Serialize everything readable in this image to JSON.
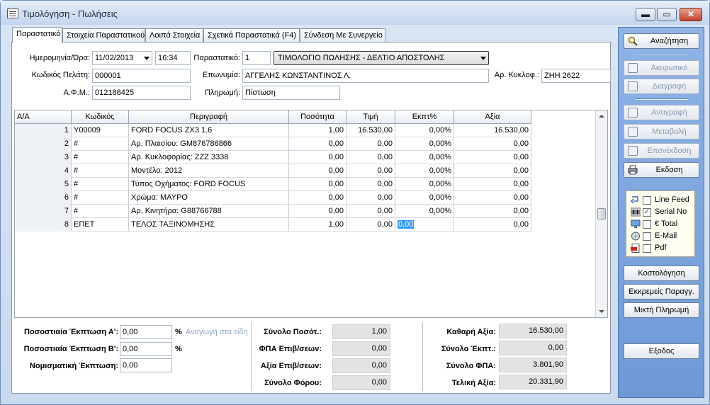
{
  "window": {
    "title": "Τιμολόγηση - Πωλήσεις",
    "min_glyph": "▬",
    "max_glyph": "▭",
    "close_glyph": "✕"
  },
  "tabs": [
    {
      "label": "Παραστατικό"
    },
    {
      "label": "Στοιχεία Παραστατικού"
    },
    {
      "label": "Λοιπά Στοιχεία"
    },
    {
      "label": "Σχετικά Παραστατικά (F4)"
    },
    {
      "label": "Σύνδεση Με Συνεργείο"
    }
  ],
  "header": {
    "date_label": "Ημερομηνία/Ώρα:",
    "date_value": "11/02/2013",
    "time_value": "16:34",
    "doc_label": "Παραστατικό:",
    "doc_number": "1",
    "doc_type": "ΤΙΜΟΛΟΓΙΟ ΠΩΛΗΣΗΣ - ΔΕΛΤΙΟ ΑΠΟΣΤΟΛΗΣ",
    "customer_code_label": "Κωδικός Πελάτη:",
    "customer_code": "000001",
    "name_label": "Επωνυμία:",
    "name_value": "ΑΓΓΕΛΗΣ ΚΩΝΣΤΑΝΤΙΝΟΣ Λ.",
    "plate_label": "Αρ. Κυκλοφ.:",
    "plate_value": "ΖΗΗ 2622",
    "afm_label": "Α.Φ.Μ.:",
    "afm_value": "012188425",
    "payment_label": "Πληρωμή:",
    "payment_value": "Πίστωση"
  },
  "grid": {
    "columns": [
      "Α/Α",
      "Κωδικός",
      "Περιγραφή",
      "Ποσότητα",
      "Τιμή",
      "Εκπτ%",
      "Αξία"
    ],
    "rows": [
      {
        "aa": "1",
        "code": "Y00009",
        "desc": "FORD FOCUS ZX3 1.6",
        "qty": "1,00",
        "price": "16.530,00",
        "disc": "0,00%",
        "value": "16.530,00"
      },
      {
        "aa": "2",
        "code": "#",
        "desc": "Αρ. Πλαισίου: GM876786866",
        "qty": "0,00",
        "price": "0,00",
        "disc": "0,00%",
        "value": "0,00"
      },
      {
        "aa": "3",
        "code": "#",
        "desc": "Αρ. Κυκλοφορίας: ZZZ 3338",
        "qty": "0,00",
        "price": "0,00",
        "disc": "0,00%",
        "value": "0,00"
      },
      {
        "aa": "4",
        "code": "#",
        "desc": "Μοντέλο: 2012",
        "qty": "0,00",
        "price": "0,00",
        "disc": "0,00%",
        "value": "0,00"
      },
      {
        "aa": "5",
        "code": "#",
        "desc": "Τύπος Οχήματος: FORD FOCUS",
        "qty": "0,00",
        "price": "0,00",
        "disc": "0,00%",
        "value": "0,00"
      },
      {
        "aa": "6",
        "code": "#",
        "desc": "Χρώμα: ΜΑΥΡΟ",
        "qty": "0,00",
        "price": "0,00",
        "disc": "0,00%",
        "value": "0,00"
      },
      {
        "aa": "7",
        "code": "#",
        "desc": "Αρ. Κινητήρα: G88766788",
        "qty": "0,00",
        "price": "0,00",
        "disc": "0,00%",
        "value": "0,00"
      },
      {
        "aa": "8",
        "code": "ΕΠΕΤ",
        "desc": "ΤΕΛΟΣ ΤΑΞΙΝΟΜΗΣΗΣ",
        "qty": "1,00",
        "price": "0,00",
        "disc": "0,00",
        "value": "0,00"
      }
    ]
  },
  "discounts": {
    "pct_a_label": "Ποσοστιαία Έκπτωση  Α':",
    "pct_a_value": "0,00",
    "pct_b_label": "Ποσοστιαία Έκπτωση  Β':",
    "pct_b_value": "0,00",
    "money_label": "Νομισματική Έκπτωση:",
    "money_value": "0,00",
    "pct_sign": "%",
    "reduce_hint": "Αναγωγή στα είδη"
  },
  "totals_mid": [
    {
      "label": "Σύνολο Ποσότ.:",
      "value": "1,00"
    },
    {
      "label": "ΦΠΑ Επιβ/σεων:",
      "value": "0,00"
    },
    {
      "label": "Αξία Επιβ/σεων:",
      "value": "0,00"
    },
    {
      "label": "Σύνολο Φόρου:",
      "value": "0,00"
    }
  ],
  "totals_right": [
    {
      "label": "Καθαρή Αξία:",
      "value": "16.530,00"
    },
    {
      "label": "Σύνολο Έκπτ.:",
      "value": "0,00"
    },
    {
      "label": "Σύνολο ΦΠΑ:",
      "value": "3.801,90"
    },
    {
      "label": "Τελική Αξία:",
      "value": "20.331,90"
    }
  ],
  "side": {
    "search": "Αναζήτηση",
    "cancel": "Ακυρωτικό",
    "delete": "Διαγραφή",
    "copy": "Αντιγραφή",
    "modify": "Μεταβολή",
    "reissue": "Επανέκδοση",
    "issue": "Εκδοση",
    "options": [
      {
        "label": "Line Feed",
        "checked": false,
        "icon": "line-feed-icon"
      },
      {
        "label": "Serial No",
        "checked": true,
        "icon": "barcode-icon"
      },
      {
        "label": "€ Total",
        "checked": false,
        "icon": "monitor-icon"
      },
      {
        "label": "E-Mail",
        "checked": false,
        "icon": "email-icon"
      },
      {
        "label": "Pdf",
        "checked": false,
        "icon": "pdf-icon"
      }
    ],
    "check_glyph": "✓",
    "costing": "Κοστολόγηση",
    "pending": "Εκκρεμείς Παραγγ.",
    "mixed": "Μικτή Πληρωμή",
    "exit": "Εξοδος"
  }
}
